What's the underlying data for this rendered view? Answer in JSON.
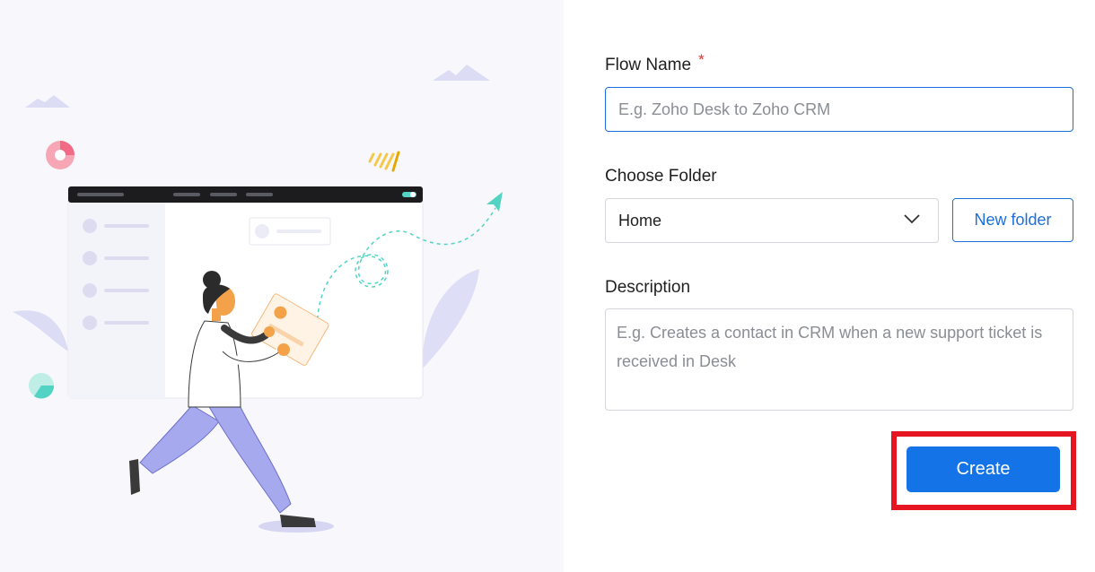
{
  "form": {
    "flow_name_label": "Flow Name",
    "required_mark": "*",
    "flow_name_placeholder": "E.g. Zoho Desk to Zoho CRM",
    "flow_name_value": "",
    "folder_label": "Choose Folder",
    "folder_selected": "Home",
    "new_folder_label": "New folder",
    "description_label": "Description",
    "description_placeholder": "E.g. Creates a contact in CRM when a new support ticket is received in Desk",
    "description_value": "",
    "create_label": "Create"
  },
  "illustration": {
    "name": "person-carrying-window-illustration"
  },
  "colors": {
    "accent": "#1473e6",
    "highlight": "#e51522",
    "left_bg": "#f8f8fc"
  }
}
